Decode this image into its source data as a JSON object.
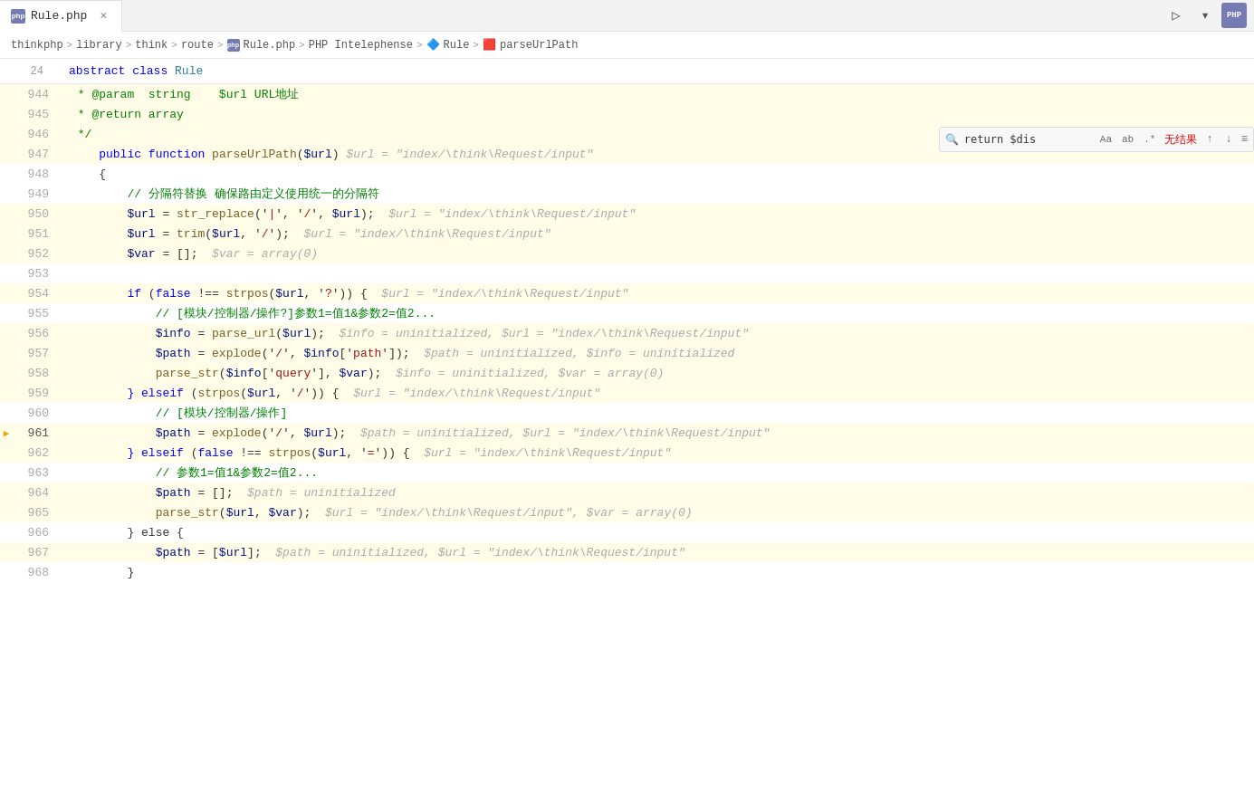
{
  "tab": {
    "icon": "PHP",
    "filename": "Rule.php",
    "close_label": "×"
  },
  "toolbar": {
    "run_icon": "▷",
    "dropdown_icon": "▾",
    "php_label": "PHP"
  },
  "breadcrumb": {
    "items": [
      {
        "label": "thinkphp",
        "type": "folder"
      },
      {
        "label": "library",
        "type": "folder"
      },
      {
        "label": "think",
        "type": "folder"
      },
      {
        "label": "route",
        "type": "folder"
      },
      {
        "label": "Rule.php",
        "type": "php-file"
      },
      {
        "label": "PHP Intelephense",
        "type": "tool"
      },
      {
        "label": "Rule",
        "type": "class"
      },
      {
        "label": "parseUrlPath",
        "type": "function"
      }
    ]
  },
  "search": {
    "query": "return $dis",
    "placeholder": "",
    "no_result_label": "无结果",
    "opt_aa": "Aa",
    "opt_ab": "ab",
    "opt_regex": ".*",
    "nav_up": "↑",
    "nav_down": "↓",
    "menu": "≡"
  },
  "header_line": {
    "line_num": "24",
    "code": "abstract class Rule"
  },
  "lines": [
    {
      "num": "944",
      "highlighted": true,
      "current": false,
      "exec": false,
      "tokens": [
        {
          "t": " * @param  string    ",
          "c": "comment"
        },
        {
          "t": "$url",
          "c": "comment"
        },
        {
          "t": " URL地址",
          "c": "comment"
        }
      ]
    },
    {
      "num": "945",
      "highlighted": true,
      "current": false,
      "exec": false,
      "tokens": [
        {
          "t": " * @return array",
          "c": "comment"
        }
      ]
    },
    {
      "num": "946",
      "highlighted": true,
      "current": false,
      "exec": false,
      "tokens": [
        {
          "t": " */",
          "c": "comment"
        }
      ]
    },
    {
      "num": "947",
      "highlighted": true,
      "current": false,
      "exec": false,
      "tokens": [
        {
          "t": "    ",
          "c": ""
        },
        {
          "t": "public",
          "c": "keyword"
        },
        {
          "t": " ",
          "c": ""
        },
        {
          "t": "function",
          "c": "keyword"
        },
        {
          "t": " ",
          "c": ""
        },
        {
          "t": "parseUrlPath",
          "c": "func-yellow"
        },
        {
          "t": "(",
          "c": ""
        },
        {
          "t": "$url",
          "c": "var-blue"
        },
        {
          "t": ") ",
          "c": ""
        },
        {
          "t": "$url = \"index/\\think\\Request/input\"",
          "c": "hint-gray"
        }
      ]
    },
    {
      "num": "948",
      "highlighted": false,
      "current": false,
      "exec": false,
      "tokens": [
        {
          "t": "    {",
          "c": ""
        }
      ]
    },
    {
      "num": "949",
      "highlighted": false,
      "current": false,
      "exec": false,
      "tokens": [
        {
          "t": "        ",
          "c": ""
        },
        {
          "t": "// 分隔符替换 确保路由定义使用统一的分隔符",
          "c": "comment"
        }
      ]
    },
    {
      "num": "950",
      "highlighted": true,
      "current": false,
      "exec": false,
      "tokens": [
        {
          "t": "        ",
          "c": ""
        },
        {
          "t": "$url",
          "c": "var-blue"
        },
        {
          "t": " = ",
          "c": ""
        },
        {
          "t": "str_replace",
          "c": "func-yellow"
        },
        {
          "t": "('",
          "c": ""
        },
        {
          "t": "|",
          "c": "str-red"
        },
        {
          "t": "', '",
          "c": ""
        },
        {
          "t": "/",
          "c": "str-red"
        },
        {
          "t": "', ",
          "c": ""
        },
        {
          "t": "$url",
          "c": "var-blue"
        },
        {
          "t": ");  ",
          "c": ""
        },
        {
          "t": "$url = \"index/\\think\\Request/input\"",
          "c": "hint-gray"
        }
      ]
    },
    {
      "num": "951",
      "highlighted": true,
      "current": false,
      "exec": false,
      "tokens": [
        {
          "t": "        ",
          "c": ""
        },
        {
          "t": "$url",
          "c": "var-blue"
        },
        {
          "t": " = ",
          "c": ""
        },
        {
          "t": "trim",
          "c": "func-yellow"
        },
        {
          "t": "(",
          "c": ""
        },
        {
          "t": "$url",
          "c": "var-blue"
        },
        {
          "t": ", '",
          "c": ""
        },
        {
          "t": "/",
          "c": "str-red"
        },
        {
          "t": "');  ",
          "c": ""
        },
        {
          "t": "$url = \"index/\\think\\Request/input\"",
          "c": "hint-gray"
        }
      ]
    },
    {
      "num": "952",
      "highlighted": true,
      "current": false,
      "exec": false,
      "tokens": [
        {
          "t": "        ",
          "c": ""
        },
        {
          "t": "$var",
          "c": "var-blue"
        },
        {
          "t": " = [];  ",
          "c": ""
        },
        {
          "t": "$var = array(0)",
          "c": "hint-gray"
        }
      ]
    },
    {
      "num": "953",
      "highlighted": false,
      "current": false,
      "exec": false,
      "tokens": []
    },
    {
      "num": "954",
      "highlighted": true,
      "current": false,
      "exec": false,
      "tokens": [
        {
          "t": "        ",
          "c": ""
        },
        {
          "t": "if",
          "c": "keyword"
        },
        {
          "t": " (",
          "c": ""
        },
        {
          "t": "false",
          "c": "keyword"
        },
        {
          "t": " !== ",
          "c": ""
        },
        {
          "t": "strpos",
          "c": "func-yellow"
        },
        {
          "t": "(",
          "c": ""
        },
        {
          "t": "$url",
          "c": "var-blue"
        },
        {
          "t": ", '",
          "c": ""
        },
        {
          "t": "?",
          "c": "str-red"
        },
        {
          "t": "')) {  ",
          "c": ""
        },
        {
          "t": "$url = \"index/\\think\\Request/input\"",
          "c": "hint-gray"
        }
      ]
    },
    {
      "num": "955",
      "highlighted": false,
      "current": false,
      "exec": false,
      "tokens": [
        {
          "t": "            ",
          "c": ""
        },
        {
          "t": "// [模块/控制器/操作?]参数1=值1&参数2=值2...",
          "c": "comment"
        }
      ]
    },
    {
      "num": "956",
      "highlighted": true,
      "current": false,
      "exec": false,
      "tokens": [
        {
          "t": "            ",
          "c": ""
        },
        {
          "t": "$info",
          "c": "var-blue"
        },
        {
          "t": " = ",
          "c": ""
        },
        {
          "t": "parse_url",
          "c": "func-yellow"
        },
        {
          "t": "(",
          "c": ""
        },
        {
          "t": "$url",
          "c": "var-blue"
        },
        {
          "t": ");  ",
          "c": ""
        },
        {
          "t": "$info = uninitialized, $url = \"index/\\think\\Request/input\"",
          "c": "hint-gray"
        }
      ]
    },
    {
      "num": "957",
      "highlighted": true,
      "current": false,
      "exec": false,
      "tokens": [
        {
          "t": "            ",
          "c": ""
        },
        {
          "t": "$path",
          "c": "var-blue"
        },
        {
          "t": " = ",
          "c": ""
        },
        {
          "t": "explode",
          "c": "func-yellow"
        },
        {
          "t": "('",
          "c": ""
        },
        {
          "t": "/",
          "c": "str-red"
        },
        {
          "t": "', ",
          "c": ""
        },
        {
          "t": "$info",
          "c": "var-blue"
        },
        {
          "t": "['",
          "c": ""
        },
        {
          "t": "path",
          "c": "str-red"
        },
        {
          "t": "']);  ",
          "c": ""
        },
        {
          "t": "$path = uninitialized, $info = uninitialized",
          "c": "hint-gray"
        }
      ]
    },
    {
      "num": "958",
      "highlighted": true,
      "current": false,
      "exec": false,
      "tokens": [
        {
          "t": "            ",
          "c": ""
        },
        {
          "t": "parse_str",
          "c": "func-yellow"
        },
        {
          "t": "(",
          "c": ""
        },
        {
          "t": "$info",
          "c": "var-blue"
        },
        {
          "t": "['",
          "c": ""
        },
        {
          "t": "query",
          "c": "str-red"
        },
        {
          "t": "'], ",
          "c": ""
        },
        {
          "t": "$var",
          "c": "var-blue"
        },
        {
          "t": ");  ",
          "c": ""
        },
        {
          "t": "$info = uninitialized, $var = array(0)",
          "c": "hint-gray"
        }
      ]
    },
    {
      "num": "959",
      "highlighted": true,
      "current": false,
      "exec": false,
      "tokens": [
        {
          "t": "        ",
          "c": ""
        },
        {
          "t": "} elseif",
          "c": "keyword"
        },
        {
          "t": " (",
          "c": ""
        },
        {
          "t": "strpos",
          "c": "func-yellow"
        },
        {
          "t": "(",
          "c": ""
        },
        {
          "t": "$url",
          "c": "var-blue"
        },
        {
          "t": ", '",
          "c": ""
        },
        {
          "t": "/",
          "c": "str-red"
        },
        {
          "t": "')) {  ",
          "c": ""
        },
        {
          "t": "$url = \"index/\\think\\Request/input\"",
          "c": "hint-gray"
        }
      ]
    },
    {
      "num": "960",
      "highlighted": false,
      "current": false,
      "exec": false,
      "tokens": [
        {
          "t": "            ",
          "c": ""
        },
        {
          "t": "// [模块/控制器/操作]",
          "c": "comment"
        }
      ]
    },
    {
      "num": "961",
      "highlighted": true,
      "current": true,
      "exec": true,
      "tokens": [
        {
          "t": "            ",
          "c": ""
        },
        {
          "t": "$path",
          "c": "var-blue"
        },
        {
          "t": " = ",
          "c": ""
        },
        {
          "t": "explode",
          "c": "func-yellow"
        },
        {
          "t": "('",
          "c": ""
        },
        {
          "t": "/",
          "c": "str-red"
        },
        {
          "t": "', ",
          "c": ""
        },
        {
          "t": "$url",
          "c": "var-blue"
        },
        {
          "t": ");  ",
          "c": ""
        },
        {
          "t": "$path = uninitialized, $url = \"index/\\think\\Request/input\"",
          "c": "hint-gray"
        }
      ]
    },
    {
      "num": "962",
      "highlighted": true,
      "current": false,
      "exec": false,
      "tokens": [
        {
          "t": "        ",
          "c": ""
        },
        {
          "t": "} elseif",
          "c": "keyword"
        },
        {
          "t": " (",
          "c": ""
        },
        {
          "t": "false",
          "c": "keyword"
        },
        {
          "t": " !== ",
          "c": ""
        },
        {
          "t": "strpos",
          "c": "func-yellow"
        },
        {
          "t": "(",
          "c": ""
        },
        {
          "t": "$url",
          "c": "var-blue"
        },
        {
          "t": ", '",
          "c": ""
        },
        {
          "t": "=",
          "c": "str-red"
        },
        {
          "t": "')) {  ",
          "c": ""
        },
        {
          "t": "$url = \"index/\\think\\Request/input\"",
          "c": "hint-gray"
        }
      ]
    },
    {
      "num": "963",
      "highlighted": false,
      "current": false,
      "exec": false,
      "tokens": [
        {
          "t": "            ",
          "c": ""
        },
        {
          "t": "// 参数1=值1&参数2=值2...",
          "c": "comment"
        }
      ]
    },
    {
      "num": "964",
      "highlighted": true,
      "current": false,
      "exec": false,
      "tokens": [
        {
          "t": "            ",
          "c": ""
        },
        {
          "t": "$path",
          "c": "var-blue"
        },
        {
          "t": " = [];  ",
          "c": ""
        },
        {
          "t": "$path = uninitialized",
          "c": "hint-gray"
        }
      ]
    },
    {
      "num": "965",
      "highlighted": true,
      "current": false,
      "exec": false,
      "tokens": [
        {
          "t": "            ",
          "c": ""
        },
        {
          "t": "parse_str",
          "c": "func-yellow"
        },
        {
          "t": "(",
          "c": ""
        },
        {
          "t": "$url",
          "c": "var-blue"
        },
        {
          "t": ", ",
          "c": ""
        },
        {
          "t": "$var",
          "c": "var-blue"
        },
        {
          "t": ");  ",
          "c": ""
        },
        {
          "t": "$url = \"index/\\think\\Request/input\", $var = array(0)",
          "c": "hint-gray"
        }
      ]
    },
    {
      "num": "966",
      "highlighted": false,
      "current": false,
      "exec": false,
      "tokens": [
        {
          "t": "        ",
          "c": ""
        },
        {
          "t": "} else {",
          "c": ""
        }
      ]
    },
    {
      "num": "967",
      "highlighted": true,
      "current": false,
      "exec": false,
      "tokens": [
        {
          "t": "            ",
          "c": ""
        },
        {
          "t": "$path",
          "c": "var-blue"
        },
        {
          "t": " = [",
          "c": ""
        },
        {
          "t": "$url",
          "c": "var-blue"
        },
        {
          "t": "];  ",
          "c": ""
        },
        {
          "t": "$path = uninitialized, $url = \"index/\\think\\Request/input\"",
          "c": "hint-gray"
        }
      ]
    },
    {
      "num": "968",
      "highlighted": false,
      "current": false,
      "exec": false,
      "tokens": [
        {
          "t": "        }",
          "c": ""
        }
      ]
    }
  ]
}
